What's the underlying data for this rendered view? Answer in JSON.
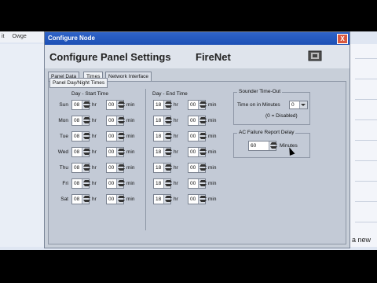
{
  "bg": {
    "menu": [
      "it",
      "Owge"
    ],
    "right_text": "a new"
  },
  "dialog": {
    "title": "Configure Node",
    "close_glyph": "X",
    "heading": "Configure Panel Settings",
    "brand": "FireNet",
    "tabs": [
      "Panel Data",
      "Times",
      "Network Interface"
    ],
    "active_tab": "Times",
    "subtab": "Panel Day/Night Times",
    "start_header": "Day - Start Time",
    "end_header": "Day - End Time",
    "hr_label": "hr",
    "min_label": "min",
    "days": [
      {
        "name": "Sun",
        "start_hr": "08",
        "start_min": "00",
        "end_hr": "18",
        "end_min": "00"
      },
      {
        "name": "Mon",
        "start_hr": "08",
        "start_min": "00",
        "end_hr": "18",
        "end_min": "00"
      },
      {
        "name": "Tue",
        "start_hr": "08",
        "start_min": "00",
        "end_hr": "18",
        "end_min": "00"
      },
      {
        "name": "Wed",
        "start_hr": "08",
        "start_min": "00",
        "end_hr": "18",
        "end_min": "00"
      },
      {
        "name": "Thu",
        "start_hr": "08",
        "start_min": "00",
        "end_hr": "18",
        "end_min": "00"
      },
      {
        "name": "Fri",
        "start_hr": "08",
        "start_min": "00",
        "end_hr": "18",
        "end_min": "00"
      },
      {
        "name": "Sat",
        "start_hr": "08",
        "start_min": "00",
        "end_hr": "18",
        "end_min": "00"
      }
    ],
    "sounder": {
      "title": "Sounder Time-Out",
      "label": "Time on in Minutes",
      "value": "0",
      "note": "(0 = Disabled)"
    },
    "ac": {
      "title": "AC Failure Report Delay",
      "value": "60",
      "unit": "Minutes"
    }
  }
}
